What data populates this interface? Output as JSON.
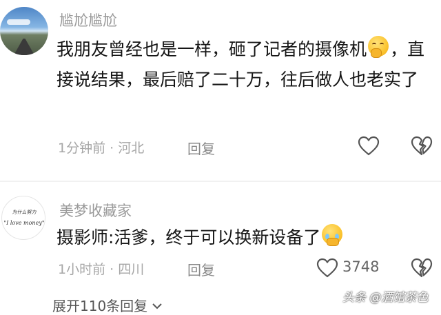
{
  "comments": [
    {
      "username": "尴尬尴尬",
      "text_before": "我朋友曾经也是一样，砸了记者的摄像机",
      "emoji": "hand-over-mouth-emoji",
      "text_after": "，直接说结果，最后赔了二十万，往后做人也老实了",
      "time_location": "1分钟前 · 河北",
      "reply_label": "回复"
    },
    {
      "username": "美梦收藏家",
      "avatar_text_line1": "为什么努力",
      "avatar_text_line2": "\"I love money\"",
      "text": "摄影师:活爹，终于可以换新设备了",
      "emoji": "pleading-tears-emoji",
      "time_location": "1小时前 · 四川",
      "reply_label": "回复",
      "like_count": "3748"
    }
  ],
  "expand_replies": "展开110条回复",
  "watermark": "头条 @酒馆茶色",
  "colors": {
    "username": "#9a9a9a",
    "body_text": "#161616",
    "meta_text": "#a6a6a6",
    "divider": "#f1f1f1"
  }
}
